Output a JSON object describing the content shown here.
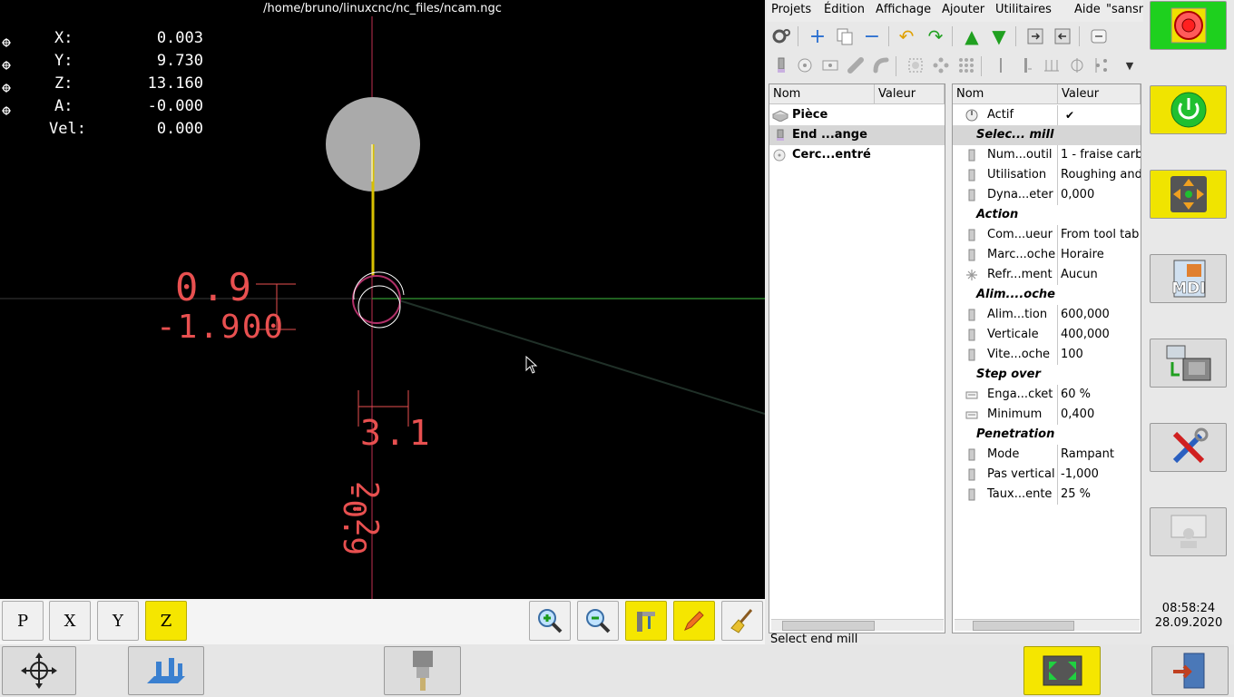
{
  "window": {
    "title": "/home/bruno/linuxcnc/nc_files/ncam.ngc"
  },
  "dro": [
    {
      "axis": "X:",
      "value": "0.003"
    },
    {
      "axis": "Y:",
      "value": "9.730"
    },
    {
      "axis": "Z:",
      "value": "13.160"
    },
    {
      "axis": "A:",
      "value": "-0.000"
    },
    {
      "axis": "Vel:",
      "value": "0.000"
    }
  ],
  "preview": {
    "dim_labels": [
      "0.9",
      "-1.900",
      "3.1",
      "2.2",
      "-0.9"
    ]
  },
  "viewbar": {
    "views": [
      "P",
      "X",
      "Y",
      "Z"
    ],
    "active_view": "Z"
  },
  "menu": [
    {
      "label": "Projets"
    },
    {
      "label": "Édition"
    },
    {
      "label": "Affichage"
    },
    {
      "label": "Ajouter"
    },
    {
      "label": "Utilitaires"
    },
    {
      "label": "Aide"
    },
    {
      "label": "\"sansn"
    }
  ],
  "project_tree": {
    "headers": [
      "Nom",
      "Valeur"
    ],
    "items": [
      {
        "name": "Pièce",
        "icon": "stock-icon",
        "selected": false
      },
      {
        "name": "End ...ange",
        "icon": "end-mill-icon",
        "selected": true
      },
      {
        "name": "Cerc...entré",
        "icon": "circle-icon",
        "selected": false
      }
    ]
  },
  "properties": {
    "headers": [
      "Nom",
      "Valeur"
    ],
    "rows": [
      {
        "type": "item",
        "name": "Actif",
        "value": "✔",
        "icon": "power-icon",
        "selected": false
      },
      {
        "type": "category",
        "name": "Selec... mill",
        "selected": true
      },
      {
        "type": "item",
        "name": "Num...outil",
        "value": "1 - fraise carb",
        "icon": "tool-icon"
      },
      {
        "type": "item",
        "name": "Utilisation",
        "value": "Roughing and",
        "icon": "usage-icon"
      },
      {
        "type": "item",
        "name": "Dyna...eter",
        "value": "0,000",
        "icon": "diameter-icon"
      },
      {
        "type": "category",
        "name": "Action"
      },
      {
        "type": "item",
        "name": "Com...ueur",
        "value": "From tool tab",
        "icon": "compensation-icon"
      },
      {
        "type": "item",
        "name": "Marc...oche",
        "value": "Horaire",
        "icon": "spindle-icon"
      },
      {
        "type": "item",
        "name": "Refr...ment",
        "value": "Aucun",
        "icon": "coolant-icon"
      },
      {
        "type": "category",
        "name": "Alim....oche"
      },
      {
        "type": "item",
        "name": "Alim...tion",
        "value": "600,000",
        "icon": "feed-icon"
      },
      {
        "type": "item",
        "name": "Verticale",
        "value": "400,000",
        "icon": "plunge-icon"
      },
      {
        "type": "item",
        "name": "Vite...oche",
        "value": "100",
        "icon": "speed-icon"
      },
      {
        "type": "category",
        "name": "Step over"
      },
      {
        "type": "item",
        "name": "Enga...cket",
        "value": "60 %",
        "icon": "engagement-icon"
      },
      {
        "type": "item",
        "name": "Minimum",
        "value": "0,400",
        "icon": "minimum-icon"
      },
      {
        "type": "category",
        "name": "Penetration"
      },
      {
        "type": "item",
        "name": "Mode",
        "value": "Rampant",
        "icon": "mode-icon"
      },
      {
        "type": "item",
        "name": "Pas vertical",
        "value": "-1,000",
        "icon": "step-down-icon"
      },
      {
        "type": "item",
        "name": "Taux...ente",
        "value": "25 %",
        "icon": "ramp-rate-icon"
      }
    ]
  },
  "status": {
    "text": "Select end mill"
  },
  "clock": {
    "time": "08:58:24",
    "date": "28.09.2020"
  },
  "right_buttons": [
    {
      "name": "emergency-stop-button",
      "icon": "estop-icon",
      "color": "#1ed01e"
    },
    {
      "name": "machine-power-button",
      "icon": "power-on-icon",
      "color": "#f0e400"
    },
    {
      "name": "manual-mode-button",
      "icon": "jog-arrows-icon",
      "color": "#f0e400"
    },
    {
      "name": "mdi-button",
      "icon": "mdi-icon",
      "label": "MDI"
    },
    {
      "name": "auto-mode-button",
      "icon": "auto-cnc-icon"
    },
    {
      "name": "settings-button",
      "icon": "tools-icon"
    },
    {
      "name": "user-tab-button",
      "icon": "user-tab-icon"
    }
  ],
  "colors": {
    "estop": "#1ed01e",
    "active": "#f5e600",
    "dim": "#e85050",
    "tool": "#aaaaaa"
  }
}
